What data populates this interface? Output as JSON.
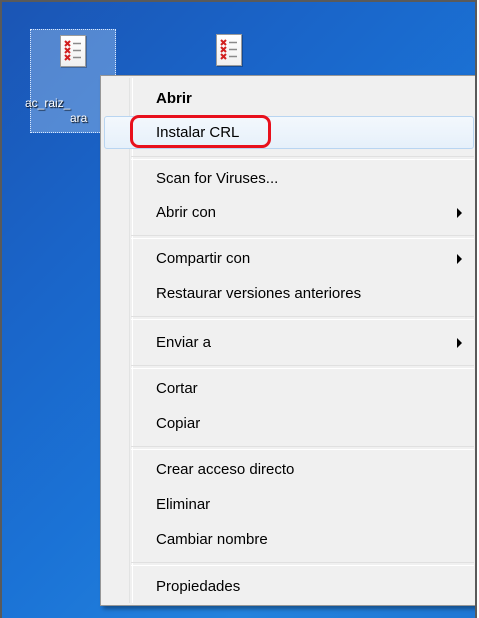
{
  "desktop": {
    "icons": [
      {
        "caption_line1": "ac_raiz_",
        "caption_line2": "ara",
        "icon": "certificate-revocation-list-icon",
        "selected": true
      },
      {
        "caption_line1": "",
        "caption_line2": "",
        "icon": "certificate-revocation-list-icon",
        "selected": false
      }
    ]
  },
  "context_menu": {
    "items": [
      {
        "label": "Abrir",
        "bold": true
      },
      {
        "label": "Instalar CRL",
        "hover": true
      },
      {
        "label": "Scan for Viruses..."
      },
      {
        "label": "Abrir con",
        "submenu": true
      },
      {
        "label": "Compartir con",
        "submenu": true
      },
      {
        "label": "Restaurar versiones anteriores"
      },
      {
        "label": "Enviar a",
        "submenu": true
      },
      {
        "label": "Cortar"
      },
      {
        "label": "Copiar"
      },
      {
        "label": "Crear acceso directo"
      },
      {
        "label": "Eliminar"
      },
      {
        "label": "Cambiar nombre"
      },
      {
        "label": "Propiedades"
      }
    ]
  },
  "annotation": {
    "highlighted_item": "Instalar CRL",
    "color": "#e8101c"
  },
  "colors": {
    "desktop_blue": "#1a64c8",
    "menu_background": "#f0f0f0",
    "hover_border": "#b9d5f1"
  }
}
